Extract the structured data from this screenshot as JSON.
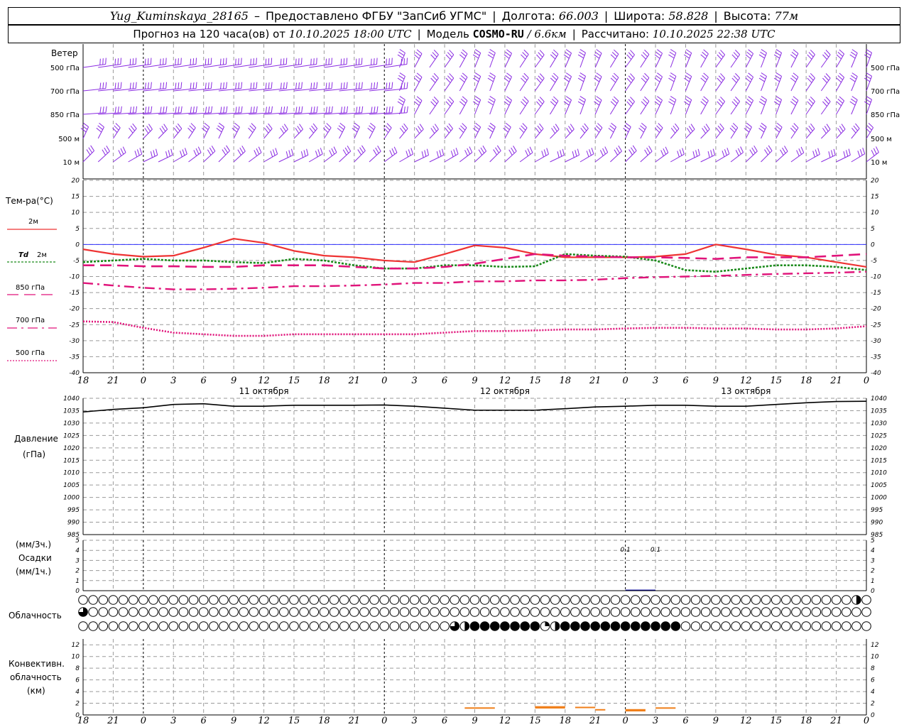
{
  "header": {
    "station": "Yug_Kuminskaya_28165",
    "dash": "–",
    "provider": "Предоставлено ФГБУ \"ЗапСиб УГМС\"",
    "lon_label": "Долгота:",
    "lon_value": "66.003",
    "lat_label": "Широта:",
    "lat_value": "58.828",
    "alt_label": "Высота:",
    "alt_value": "77м"
  },
  "subheader": {
    "forecast_prefix": "Прогноз на 120 часа(ов)  от",
    "forecast_start": "10.10.2025 18:00 UTC",
    "model_label": "Модель",
    "model_name": "COSMO-RU",
    "model_res": "/ 6.6км",
    "calc_label": "Рассчитано:",
    "calc_time": "10.10.2025 22:38 UTC"
  },
  "colors": {
    "wind": "#8a2be2",
    "t2m": "#ee3333",
    "td2m": "#1a8a1a",
    "t850": "#e0137a",
    "t700": "#e0137a",
    "t500": "#e0137a",
    "pressure": "#000000",
    "precip": "#0000aa",
    "conv": "#f07f1a",
    "grid": "#9a9a9a",
    "zero": "#3030ff"
  },
  "labels": {
    "wind_title": "Ветер",
    "wind_levels": [
      "500 гПа",
      "700 гПа",
      "850 гПа",
      "500 м",
      "10  м"
    ],
    "temp_title": "Тем-ра(°С)",
    "temp_2m": "2м",
    "temp_td": "Td",
    "temp_td_2m": "2м",
    "temp_850": "850 гПа",
    "temp_700": "700 гПа",
    "temp_500": "500 гПа",
    "pressure_title": "Давление",
    "pressure_unit": "(гПа)",
    "precip_3h": "(мм/3ч.)",
    "precip_title": "Осадки",
    "precip_1h": "(мм/1ч.)",
    "cloud_title": "Облачность",
    "conv_title1": "Конвективн.",
    "conv_title2": "облачность",
    "conv_unit": "(км)"
  },
  "chart_data": [
    {
      "type": "line",
      "title": "Тем-ра(°С)",
      "x": [
        "18",
        "21",
        "0",
        "3",
        "6",
        "9",
        "12",
        "15",
        "18",
        "21",
        "0",
        "3",
        "6",
        "9",
        "12",
        "15",
        "18",
        "21",
        "0",
        "3",
        "6",
        "9",
        "12",
        "15",
        "18",
        "21",
        "0"
      ],
      "days": [
        "11 октября",
        "12 октября",
        "13 октября"
      ],
      "ylim": [
        -40,
        20
      ],
      "yticks": [
        20,
        15,
        10,
        5,
        0,
        -5,
        -10,
        -15,
        -20,
        -25,
        -30,
        -35,
        -40
      ],
      "grid": true,
      "series": [
        {
          "name": "2м",
          "values": [
            -1.5,
            -3,
            -3.8,
            -3.5,
            -1,
            1.8,
            0.5,
            -2,
            -3.5,
            -4,
            -5,
            -5.5,
            -3,
            -0.3,
            -1,
            -3,
            -4,
            -4,
            -4,
            -3.8,
            -3,
            0,
            -1.5,
            -3.2,
            -4,
            -5.5,
            -7
          ]
        },
        {
          "name": "Td 2м",
          "values": [
            -5.5,
            -5,
            -4.5,
            -5,
            -5,
            -5.5,
            -5.8,
            -4.5,
            -5,
            -6.5,
            -7.5,
            -7.5,
            -6.5,
            -6.5,
            -7,
            -6.8,
            -3,
            -3.5,
            -3.8,
            -5,
            -8,
            -8.5,
            -7.5,
            -6.5,
            -6.5,
            -7,
            -8
          ]
        },
        {
          "name": "850 гПа",
          "values": [
            -6.5,
            -6.5,
            -6.8,
            -6.8,
            -7,
            -7,
            -6.5,
            -6.5,
            -6.5,
            -7,
            -7.5,
            -7.5,
            -7,
            -6,
            -4.5,
            -3,
            -3.5,
            -3.8,
            -4,
            -4,
            -4.2,
            -4.5,
            -4,
            -4,
            -4,
            -3.5,
            -3
          ]
        },
        {
          "name": "700 гПа",
          "values": [
            -12,
            -12.8,
            -13.5,
            -14,
            -14,
            -13.8,
            -13.5,
            -13,
            -13,
            -12.8,
            -12.5,
            -12,
            -12,
            -11.5,
            -11.5,
            -11.2,
            -11.2,
            -11,
            -10.5,
            -10.2,
            -10,
            -9.8,
            -9.5,
            -9.2,
            -9,
            -8.8,
            -8.5
          ]
        },
        {
          "name": "500 гПа",
          "values": [
            -24,
            -24.2,
            -26,
            -27.5,
            -28,
            -28.5,
            -28.5,
            -28,
            -28,
            -28,
            -28,
            -28,
            -27.5,
            -27,
            -27,
            -26.8,
            -26.5,
            -26.5,
            -26.2,
            -26,
            -26,
            -26.2,
            -26.2,
            -26.5,
            -26.5,
            -26.2,
            -25.5
          ]
        }
      ]
    },
    {
      "type": "line",
      "title": "Давление (гПа)",
      "ylim": [
        985,
        1040
      ],
      "yticks": [
        1040,
        1035,
        1030,
        1025,
        1020,
        1015,
        1010,
        1005,
        1000,
        995,
        990,
        985
      ],
      "grid": true,
      "series": [
        {
          "name": "Давление",
          "values": [
            1034.5,
            1035.5,
            1036.2,
            1037.5,
            1037.8,
            1036.8,
            1036.8,
            1037.2,
            1037.2,
            1037.2,
            1037.3,
            1036.8,
            1036,
            1035.2,
            1035.2,
            1035.2,
            1035.8,
            1036.5,
            1036.8,
            1037.2,
            1037.2,
            1036.8,
            1036.8,
            1037.5,
            1038.2,
            1038.7,
            1038.8
          ]
        }
      ]
    },
    {
      "type": "bar",
      "title": "Осадки",
      "ylim": [
        0,
        5
      ],
      "yticks": [
        5,
        4,
        3,
        2,
        1,
        0
      ],
      "annotations": [
        {
          "x": 54,
          "text": "0.1"
        },
        {
          "x": 57,
          "text": "0.1"
        }
      ],
      "values_3h": [
        {
          "start": 54,
          "end": 57,
          "value": 0.1
        }
      ]
    },
    {
      "type": "table",
      "title": "Облачность",
      "levels": [
        "high",
        "middle",
        "low"
      ],
      "steps": 79,
      "high_partial": [
        {
          "i": 77,
          "fill": 0.5
        }
      ],
      "middle_partial": [
        {
          "i": 0,
          "fill": 0.75
        }
      ],
      "low_partial": [
        {
          "i": 37,
          "fill": 0.75
        },
        {
          "i": 38,
          "fill": 0.5
        },
        {
          "i": 46,
          "fill": 0.25
        },
        {
          "i": 47,
          "fill": 0.5
        }
      ],
      "low_overcast": [
        [
          39,
          45
        ],
        [
          48,
          59
        ]
      ]
    },
    {
      "type": "bar",
      "title": "Конвективн. облачность (км)",
      "ylim": [
        0,
        13
      ],
      "yticks": [
        12,
        10,
        8,
        6,
        4,
        2,
        0
      ],
      "segments": [
        {
          "from": 38,
          "to": 41,
          "base": 1.1,
          "top": 1.3
        },
        {
          "from": 45,
          "to": 48,
          "base": 1.1,
          "top": 1.5
        },
        {
          "from": 49,
          "to": 51,
          "base": 1.2,
          "top": 1.4
        },
        {
          "from": 51,
          "to": 52,
          "base": 0.8,
          "top": 1.0
        },
        {
          "from": 54,
          "to": 56,
          "base": 0.6,
          "top": 1.0
        },
        {
          "from": 57,
          "to": 59,
          "base": 1.1,
          "top": 1.3
        }
      ]
    }
  ],
  "wind_rows": {
    "levels": 5,
    "note": "wind barbs every 1.5 h"
  }
}
